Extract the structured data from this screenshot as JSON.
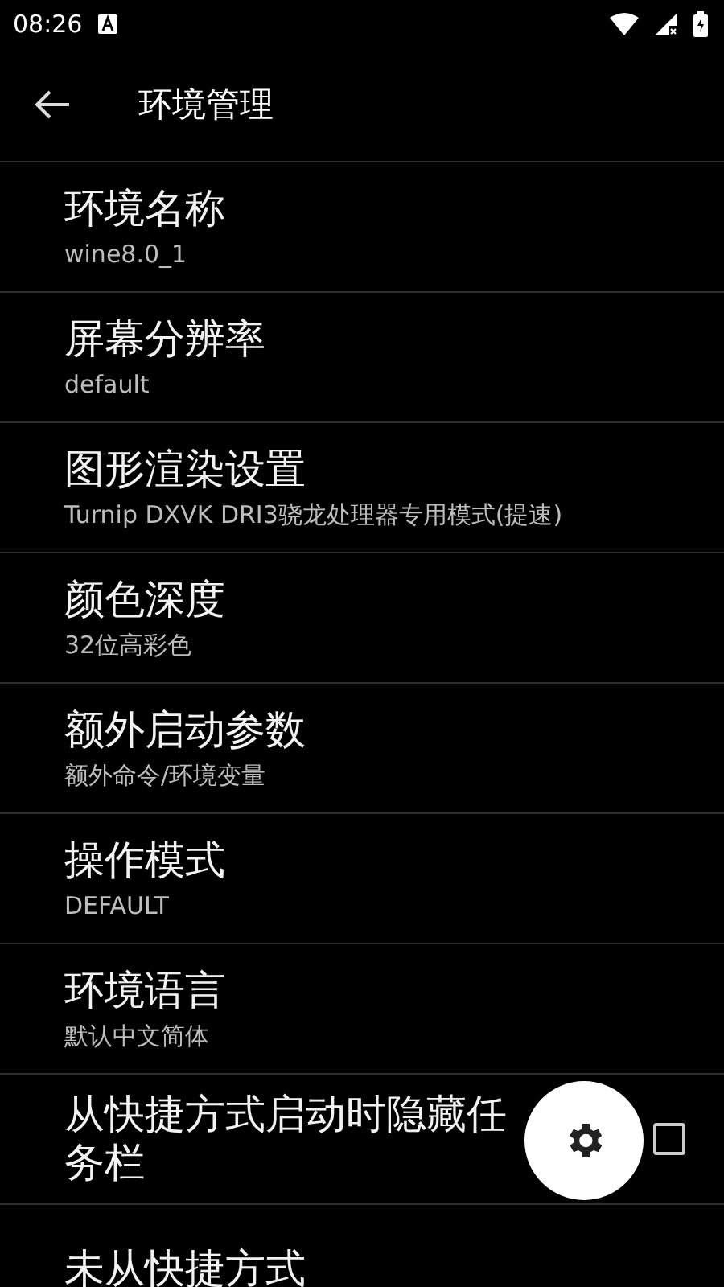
{
  "status_bar": {
    "time": "08:26"
  },
  "app_bar": {
    "title": "环境管理"
  },
  "settings": [
    {
      "kind": "text",
      "title": "环境名称",
      "value": "wine8.0_1"
    },
    {
      "kind": "text",
      "title": "屏幕分辨率",
      "value": "default"
    },
    {
      "kind": "text",
      "title": "图形渲染设置",
      "value": "Turnip DXVK DRI3骁龙处理器专用模式(提速)"
    },
    {
      "kind": "text",
      "title": "颜色深度",
      "value": "32位高彩色"
    },
    {
      "kind": "text",
      "title": "额外启动参数",
      "value": "额外命令/环境变量"
    },
    {
      "kind": "text",
      "title": "操作模式",
      "value": "DEFAULT"
    },
    {
      "kind": "text",
      "title": "环境语言",
      "value": "默认中文简体"
    },
    {
      "kind": "checkbox",
      "title": "从快捷方式启动时隐藏任务栏",
      "checked": false
    },
    {
      "kind": "text",
      "title": "未从快捷方式"
    }
  ]
}
